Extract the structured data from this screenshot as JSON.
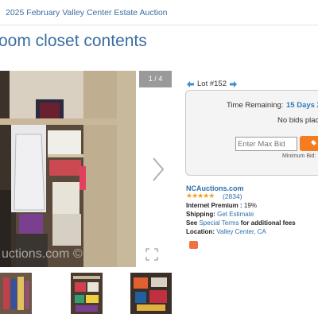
{
  "header": {
    "breadcrumb": "2025 February Valley Center Estate Auction",
    "title": "oom closet contents"
  },
  "gallery": {
    "counter": "1 / 4",
    "watermark": "uctions.com ©",
    "next_icon": "chevron-right-icon",
    "expand_icon": "expand-icon"
  },
  "lot": {
    "label": "Lot #152",
    "time_label": "Time Remaining:",
    "time_value": "15 Days 2",
    "no_bids": "No bids plac",
    "max_bid_placeholder": "Enter Max Bid",
    "min_bid": "Minimum Bid:"
  },
  "seller": {
    "name": "NCAuctions.com",
    "stars": "★★★★★",
    "rating_count": "(2834)",
    "premium_label": "Internet Premium :",
    "premium_value": "19%",
    "shipping_label": "Shipping:",
    "shipping_link": "Get Estimate",
    "see_label": "See",
    "special_terms_link": "Special Terms",
    "special_terms_suffix": "for additional fees",
    "location_label": "Location:",
    "location_link": "Valley Center, CA"
  },
  "colors": {
    "link_blue": "#3a6ea5",
    "accent_orange": "#f57c20",
    "star_gold": "#f0a020"
  }
}
